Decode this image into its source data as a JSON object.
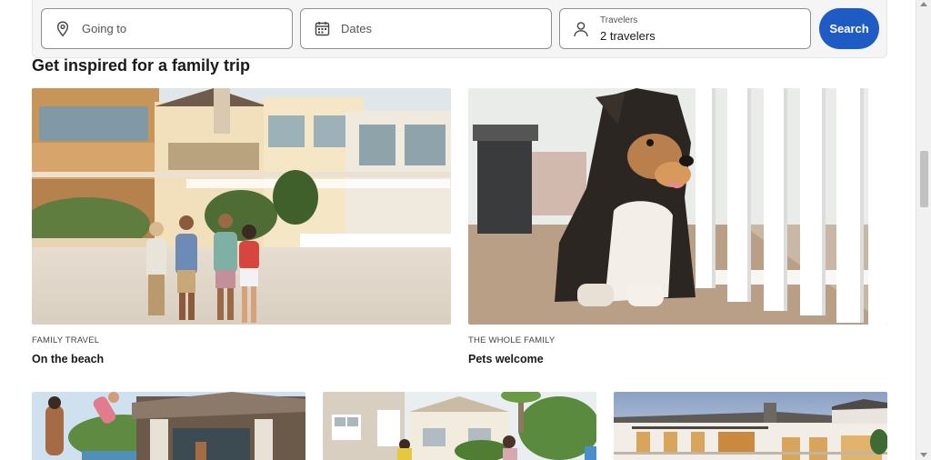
{
  "search": {
    "going_to_placeholder": "Going to",
    "dates_placeholder": "Dates",
    "travelers_label": "Travelers",
    "travelers_value": "2 travelers",
    "button_label": "Search",
    "button_color": "#1f5bc4"
  },
  "section": {
    "heading": "Get inspired for a family trip"
  },
  "cards": [
    {
      "kicker": "FAMILY TRAVEL",
      "title": "On the beach",
      "image": "family walking on beach in front of houses"
    },
    {
      "kicker": "THE WHOLE FAMILY",
      "title": "Pets welcome",
      "image": "dog lying on porch"
    },
    {
      "image": "people playing by a pool"
    },
    {
      "image": "family in front of a beach house"
    },
    {
      "image": "large villa at dusk"
    }
  ],
  "icons": {
    "going_to": "location-pin-icon",
    "dates": "calendar-icon",
    "travelers": "person-icon"
  }
}
